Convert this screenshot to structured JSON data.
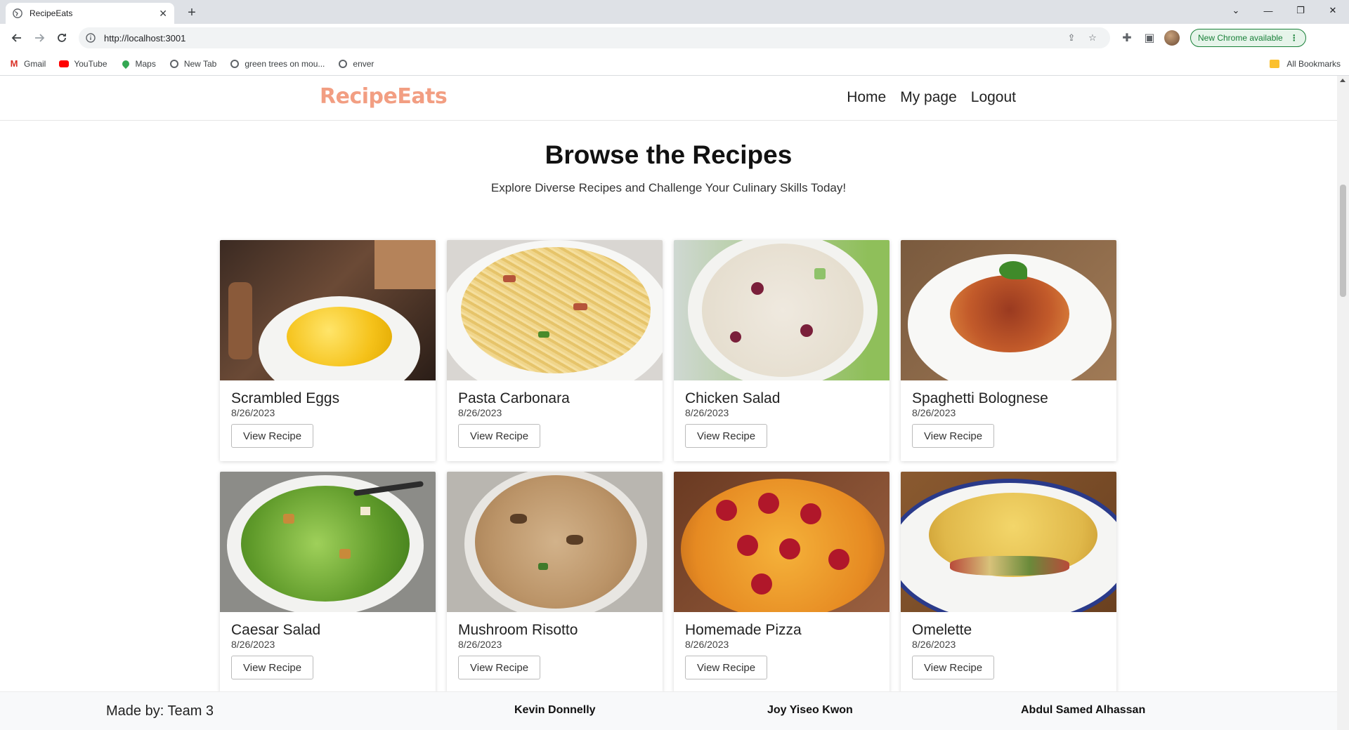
{
  "browser": {
    "tab_title": "RecipeEats",
    "url": "http://localhost:3001",
    "update_label": "New Chrome available",
    "bookmarks": [
      "Gmail",
      "YouTube",
      "Maps",
      "New Tab",
      "green trees on mou...",
      "enver"
    ],
    "all_bookmarks": "All Bookmarks"
  },
  "site": {
    "logo": "RecipeEats",
    "nav": [
      "Home",
      "My page",
      "Logout"
    ],
    "title": "Browse the Recipes",
    "subtitle": "Explore Diverse Recipes and Challenge Your Culinary Skills Today!"
  },
  "recipes": [
    {
      "name": "Scrambled Eggs",
      "date": "8/26/2023",
      "button": "View Recipe"
    },
    {
      "name": "Pasta Carbonara",
      "date": "8/26/2023",
      "button": "View Recipe"
    },
    {
      "name": "Chicken Salad",
      "date": "8/26/2023",
      "button": "View Recipe"
    },
    {
      "name": "Spaghetti Bolognese",
      "date": "8/26/2023",
      "button": "View Recipe"
    },
    {
      "name": "Caesar Salad",
      "date": "8/26/2023",
      "button": "View Recipe"
    },
    {
      "name": "Mushroom Risotto",
      "date": "8/26/2023",
      "button": "View Recipe"
    },
    {
      "name": "Homemade Pizza",
      "date": "8/26/2023",
      "button": "View Recipe"
    },
    {
      "name": "Omelette",
      "date": "8/26/2023",
      "button": "View Recipe"
    }
  ],
  "footer": {
    "made_by": "Made by: Team 3",
    "members": [
      "Kevin Donnelly",
      "Joy Yiseo Kwon",
      "Abdul Samed Alhassan"
    ]
  },
  "colors": {
    "logo": "#f29e82",
    "chrome_update": "#188038"
  }
}
